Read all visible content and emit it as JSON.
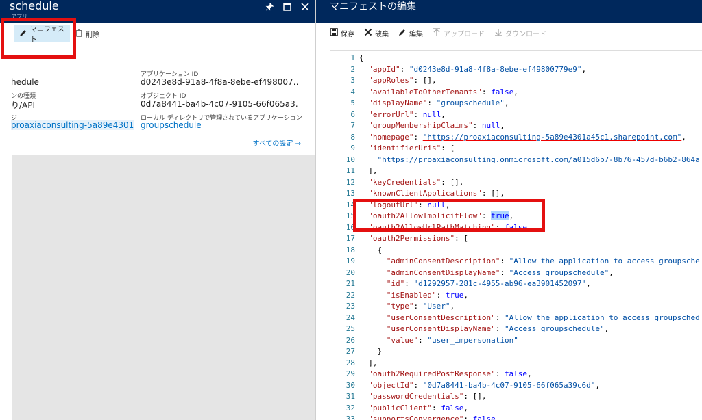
{
  "left_blade": {
    "title": "schedule",
    "subtitle": "アプリ",
    "toolbar": {
      "manifest_label": "マニフェスト",
      "delete_label": "削除"
    },
    "fields": {
      "c1_value1": "hedule",
      "c1_label2": "ンの種類",
      "c1_value2": "り/API",
      "c1_label3": "ジ",
      "c1_value3": "proaxiaconsulting-5a89e4301…",
      "app_id_label": "アプリケーション ID",
      "app_id_value": "d0243e8d-91a8-4f8a-8ebe-ef498007…",
      "object_id_label": "オブジェクト ID",
      "object_id_value": "0d7a8441-ba4b-4c07-9105-66f065a3…",
      "managed_app_label": "ローカル ディレクトリで管理されているアプリケーション",
      "managed_app_value": "groupschedule"
    },
    "all_settings_label": "すべての設定 →"
  },
  "right_blade": {
    "title": "マニフェストの編集",
    "toolbar": {
      "save": "保存",
      "discard": "破棄",
      "edit": "編集",
      "upload": "アップロード",
      "download": "ダウンロード"
    }
  },
  "editor": {
    "lines": [
      {
        "n": "1",
        "parts": [
          [
            "p",
            "{"
          ]
        ]
      },
      {
        "n": "2",
        "parts": [
          [
            "p",
            "  "
          ],
          [
            "k",
            "\"appId\""
          ],
          [
            "p",
            ": "
          ],
          [
            "s",
            "\"d0243e8d-91a8-4f8a-8ebe-ef49800779e9\""
          ],
          [
            "p",
            ","
          ]
        ]
      },
      {
        "n": "3",
        "parts": [
          [
            "p",
            "  "
          ],
          [
            "k",
            "\"appRoles\""
          ],
          [
            "p",
            ": [],"
          ]
        ]
      },
      {
        "n": "4",
        "parts": [
          [
            "p",
            "  "
          ],
          [
            "k",
            "\"availableToOtherTenants\""
          ],
          [
            "p",
            ": "
          ],
          [
            "b",
            "false"
          ],
          [
            "p",
            ","
          ]
        ]
      },
      {
        "n": "5",
        "parts": [
          [
            "p",
            "  "
          ],
          [
            "k",
            "\"displayName\""
          ],
          [
            "p",
            ": "
          ],
          [
            "s",
            "\"groupschedule\""
          ],
          [
            "p",
            ","
          ]
        ]
      },
      {
        "n": "6",
        "parts": [
          [
            "p",
            "  "
          ],
          [
            "k",
            "\"errorUrl\""
          ],
          [
            "p",
            ": "
          ],
          [
            "b",
            "null"
          ],
          [
            "p",
            ","
          ]
        ]
      },
      {
        "n": "7",
        "parts": [
          [
            "p",
            "  "
          ],
          [
            "k",
            "\"groupMembershipClaims\""
          ],
          [
            "p",
            ": "
          ],
          [
            "b",
            "null"
          ],
          [
            "p",
            ","
          ]
        ]
      },
      {
        "n": "8",
        "parts": [
          [
            "p",
            "  "
          ],
          [
            "k",
            "\"homepage\""
          ],
          [
            "p",
            ": "
          ],
          [
            "u",
            "\"https://proaxiaconsulting-5a89e4301a45c1.sharepoint.com\""
          ],
          [
            "p",
            ","
          ]
        ]
      },
      {
        "n": "9",
        "parts": [
          [
            "p",
            "  "
          ],
          [
            "k",
            "\"identifierUris\""
          ],
          [
            "p",
            ": ["
          ]
        ]
      },
      {
        "n": "10",
        "parts": [
          [
            "p",
            "    "
          ],
          [
            "u",
            "\"https://proaxiaconsulting.onmicrosoft.com/a015d6b7-8b76-457d-b6b2-864a"
          ]
        ]
      },
      {
        "n": "11",
        "parts": [
          [
            "p",
            "  ],"
          ]
        ]
      },
      {
        "n": "12",
        "parts": [
          [
            "p",
            "  "
          ],
          [
            "k",
            "\"keyCredentials\""
          ],
          [
            "p",
            ": [],"
          ]
        ]
      },
      {
        "n": "13",
        "parts": [
          [
            "p",
            "  "
          ],
          [
            "k",
            "\"knownClientApplications\""
          ],
          [
            "p",
            ": [],"
          ]
        ]
      },
      {
        "n": "14",
        "parts": [
          [
            "p",
            "  "
          ],
          [
            "k",
            "\"logoutUrl\""
          ],
          [
            "p",
            ": "
          ],
          [
            "b",
            "null"
          ],
          [
            "p",
            ","
          ]
        ]
      },
      {
        "n": "15",
        "parts": [
          [
            "p",
            "  "
          ],
          [
            "k",
            "\"oauth2AllowImplicitFlow\""
          ],
          [
            "p",
            ": "
          ],
          [
            "sel",
            "true"
          ],
          [
            "p",
            ","
          ]
        ]
      },
      {
        "n": "16",
        "parts": [
          [
            "p",
            "  "
          ],
          [
            "k",
            "\"oauth2AllowUrlPathMatching\""
          ],
          [
            "p",
            ": "
          ],
          [
            "b",
            "false"
          ],
          [
            "p",
            ","
          ]
        ]
      },
      {
        "n": "17",
        "parts": [
          [
            "p",
            "  "
          ],
          [
            "k",
            "\"oauth2Permissions\""
          ],
          [
            "p",
            ": ["
          ]
        ]
      },
      {
        "n": "18",
        "parts": [
          [
            "p",
            "    {"
          ]
        ]
      },
      {
        "n": "19",
        "parts": [
          [
            "p",
            "      "
          ],
          [
            "k",
            "\"adminConsentDescription\""
          ],
          [
            "p",
            ": "
          ],
          [
            "s",
            "\"Allow the application to access groupsche"
          ]
        ]
      },
      {
        "n": "20",
        "parts": [
          [
            "p",
            "      "
          ],
          [
            "k",
            "\"adminConsentDisplayName\""
          ],
          [
            "p",
            ": "
          ],
          [
            "s",
            "\"Access groupschedule\""
          ],
          [
            "p",
            ","
          ]
        ]
      },
      {
        "n": "21",
        "parts": [
          [
            "p",
            "      "
          ],
          [
            "k",
            "\"id\""
          ],
          [
            "p",
            ": "
          ],
          [
            "s",
            "\"d1292957-281c-4955-ab96-ea3901452097\""
          ],
          [
            "p",
            ","
          ]
        ]
      },
      {
        "n": "22",
        "parts": [
          [
            "p",
            "      "
          ],
          [
            "k",
            "\"isEnabled\""
          ],
          [
            "p",
            ": "
          ],
          [
            "b",
            "true"
          ],
          [
            "p",
            ","
          ]
        ]
      },
      {
        "n": "23",
        "parts": [
          [
            "p",
            "      "
          ],
          [
            "k",
            "\"type\""
          ],
          [
            "p",
            ": "
          ],
          [
            "s",
            "\"User\""
          ],
          [
            "p",
            ","
          ]
        ]
      },
      {
        "n": "24",
        "parts": [
          [
            "p",
            "      "
          ],
          [
            "k",
            "\"userConsentDescription\""
          ],
          [
            "p",
            ": "
          ],
          [
            "s",
            "\"Allow the application to access groupsched"
          ]
        ]
      },
      {
        "n": "25",
        "parts": [
          [
            "p",
            "      "
          ],
          [
            "k",
            "\"userConsentDisplayName\""
          ],
          [
            "p",
            ": "
          ],
          [
            "s",
            "\"Access groupschedule\""
          ],
          [
            "p",
            ","
          ]
        ]
      },
      {
        "n": "26",
        "parts": [
          [
            "p",
            "      "
          ],
          [
            "k",
            "\"value\""
          ],
          [
            "p",
            ": "
          ],
          [
            "s",
            "\"user_impersonation\""
          ]
        ]
      },
      {
        "n": "27",
        "parts": [
          [
            "p",
            "    }"
          ]
        ]
      },
      {
        "n": "28",
        "parts": [
          [
            "p",
            "  ],"
          ]
        ]
      },
      {
        "n": "29",
        "parts": [
          [
            "p",
            "  "
          ],
          [
            "k",
            "\"oauth2RequiredPostResponse\""
          ],
          [
            "p",
            ": "
          ],
          [
            "b",
            "false"
          ],
          [
            "p",
            ","
          ]
        ]
      },
      {
        "n": "30",
        "parts": [
          [
            "p",
            "  "
          ],
          [
            "k",
            "\"objectId\""
          ],
          [
            "p",
            ": "
          ],
          [
            "s",
            "\"0d7a8441-ba4b-4c07-9105-66f065a39c6d\""
          ],
          [
            "p",
            ","
          ]
        ]
      },
      {
        "n": "31",
        "parts": [
          [
            "p",
            "  "
          ],
          [
            "k",
            "\"passwordCredentials\""
          ],
          [
            "p",
            ": [],"
          ]
        ]
      },
      {
        "n": "32",
        "parts": [
          [
            "p",
            "  "
          ],
          [
            "k",
            "\"publicClient\""
          ],
          [
            "p",
            ": "
          ],
          [
            "b",
            "false"
          ],
          [
            "p",
            ","
          ]
        ]
      },
      {
        "n": "33",
        "parts": [
          [
            "p",
            "  "
          ],
          [
            "k",
            "\"supportsConvergence\""
          ],
          [
            "p",
            ": "
          ],
          [
            "b",
            "false"
          ],
          [
            "p",
            ","
          ]
        ]
      }
    ]
  },
  "colors": {
    "header": "#00285c",
    "highlight": "#e41010",
    "link": "#0072c6"
  },
  "icons": [
    "pin-icon",
    "maximize-icon",
    "close-icon",
    "pencil-icon",
    "trash-icon",
    "save-icon",
    "discard-icon",
    "upload-icon",
    "download-icon",
    "arrow-right-icon"
  ]
}
